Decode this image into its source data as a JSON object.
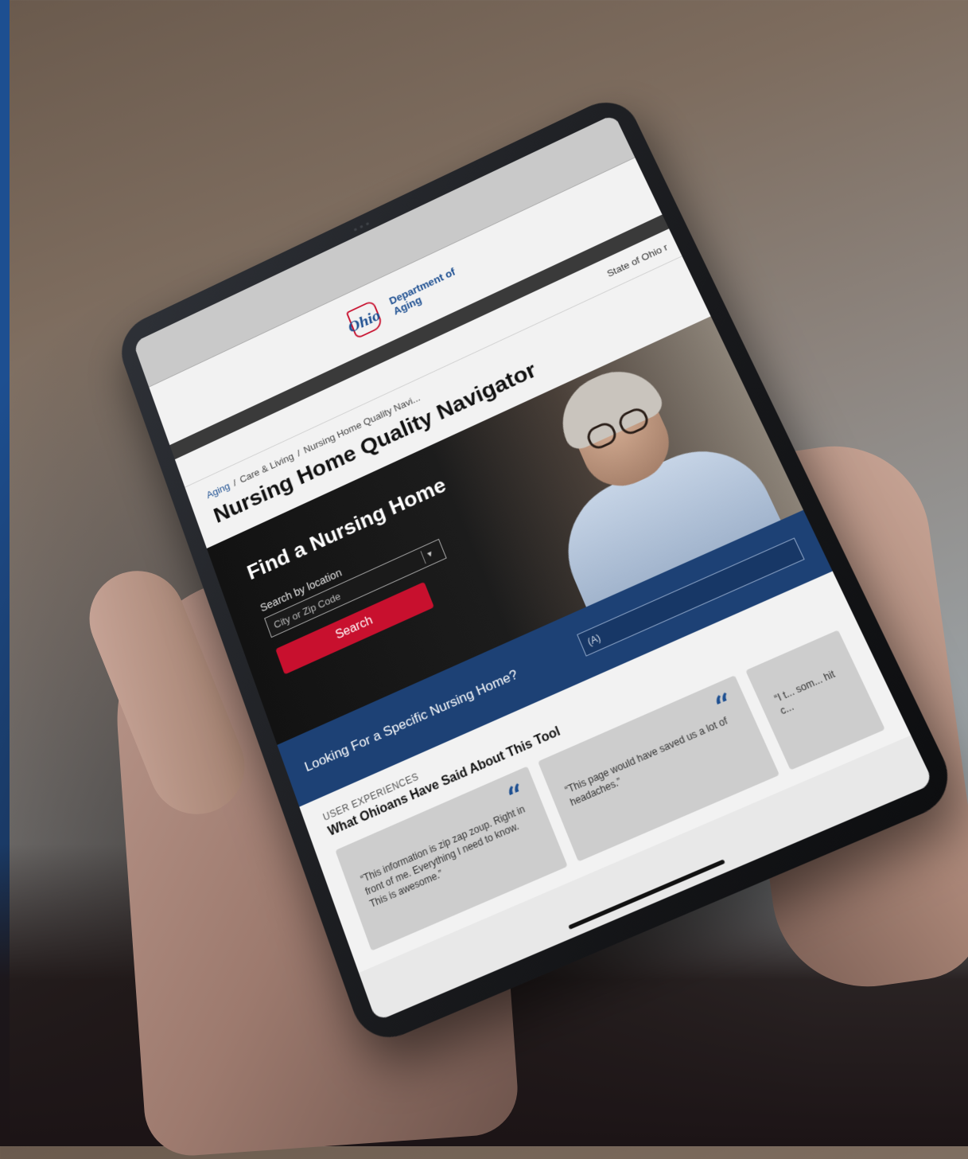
{
  "logo": {
    "word": "Ohio",
    "line1": "Department of",
    "line2": "Aging"
  },
  "topnav": {
    "link": "State of Ohio r"
  },
  "breadcrumb": {
    "items": [
      "Aging",
      "/",
      "Care & Living",
      "/",
      "Nursing Home Quality Navi..."
    ]
  },
  "page": {
    "title": "Nursing Home Quality Navigator"
  },
  "hero": {
    "title": "Find a Nursing Home",
    "label": "Search by location",
    "placeholder": "City or Zip Code",
    "button": "Search"
  },
  "specific": {
    "text": "Looking For a Specific Nursing Home?",
    "input_value": "(A)"
  },
  "experiences": {
    "label": "USER EXPERIENCES",
    "heading": "What Ohioans Have Said About This Tool",
    "quote_glyph": "“",
    "cards": [
      {
        "quote": "“This information is zip zap zoup. Right in front of me. Everything I need to know. This is awesome.”"
      },
      {
        "quote": "“This page would have saved us a lot of headaches.”"
      },
      {
        "quote": "“I t... som... hit c..."
      }
    ]
  },
  "colors": {
    "ohio_blue": "#1d4f91",
    "ohio_red": "#c8102e",
    "navy_bar": "#1d4175"
  }
}
